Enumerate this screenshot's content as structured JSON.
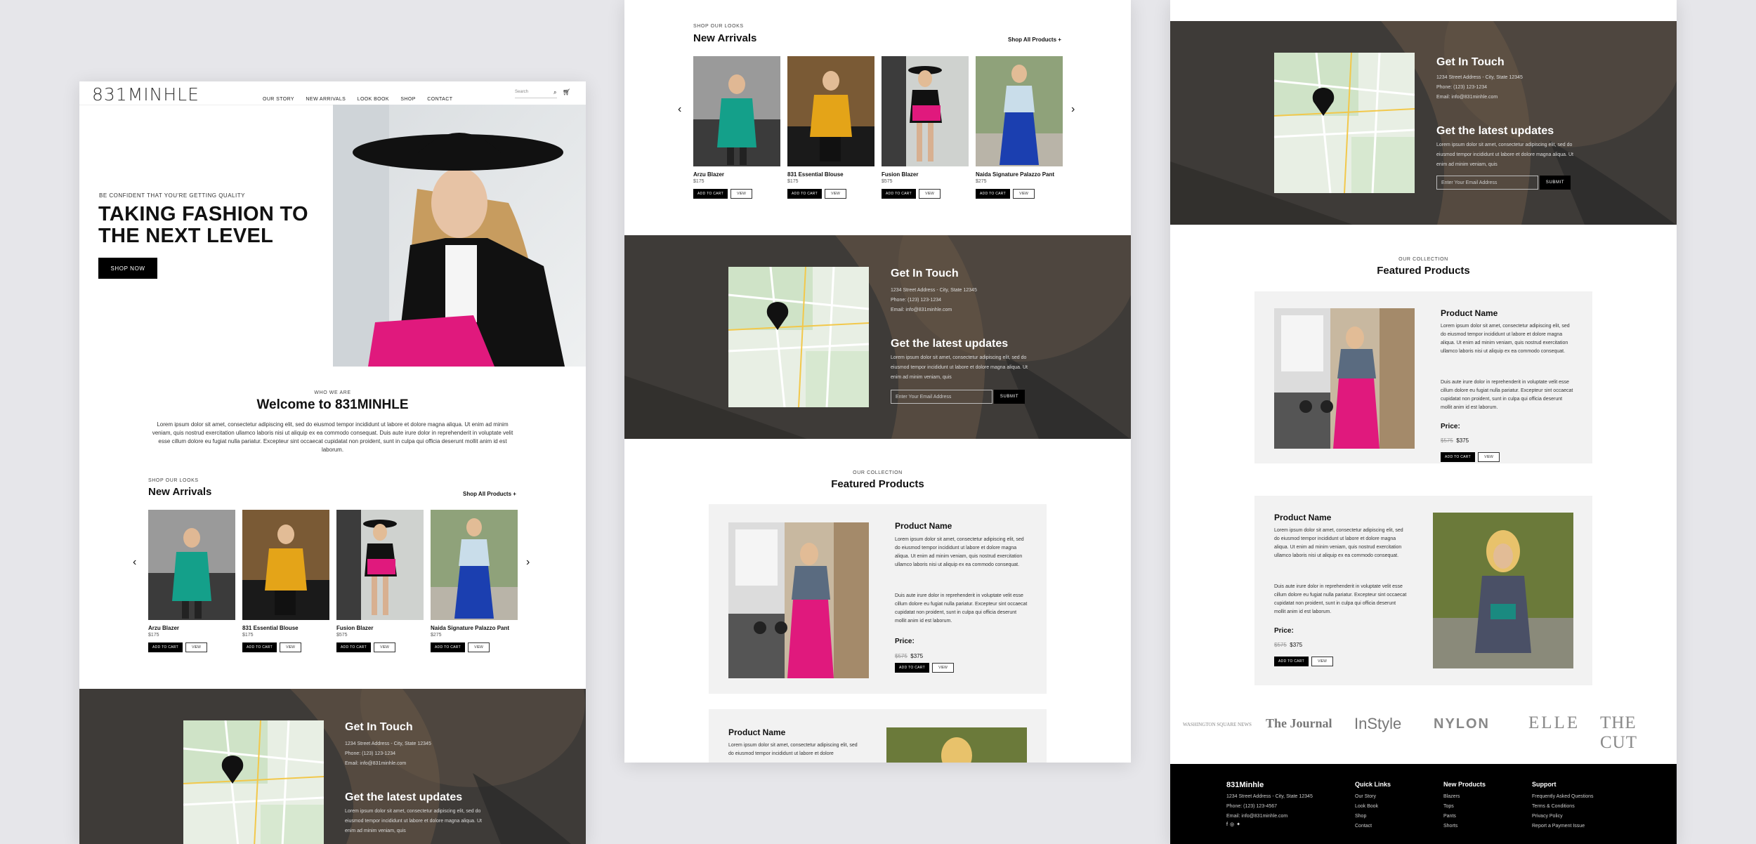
{
  "brand": {
    "logo": "831MINHLE"
  },
  "nav": {
    "items": [
      "OUR STORY",
      "NEW ARRIVALS",
      "LOOK BOOK",
      "SHOP",
      "CONTACT"
    ],
    "search_placeholder": "Search"
  },
  "hero": {
    "tagline": "BE CONFIDENT THAT YOU'RE GETTING QUALITY",
    "title_line1": "TAKING FASHION TO",
    "title_line2": "THE NEXT LEVEL",
    "cta": "SHOP NOW"
  },
  "welcome": {
    "eyebrow": "WHO WE ARE",
    "title": "Welcome to 831MINHLE",
    "body": "Lorem ipsum dolor sit amet, consectetur adipiscing elit, sed do eiusmod tempor incididunt ut labore et dolore magna aliqua. Ut enim ad minim veniam, quis nostrud exercitation ullamco laboris nisi ut aliquip ex ea commodo consequat. Duis aute irure dolor in reprehenderit in voluptate velit esse cillum dolore eu fugiat nulla pariatur. Excepteur sint occaecat cupidatat non proident, sunt in culpa qui officia deserunt mollit anim id est laborum."
  },
  "arrivals": {
    "eyebrow": "SHOP OUR LOOKS",
    "title": "New Arrivals",
    "shop_all": "Shop All Products +",
    "add_to_cart": "ADD TO CART",
    "view": "VIEW",
    "products": [
      {
        "name": "Arzu Blazer",
        "price": "$175"
      },
      {
        "name": "831 Essential Blouse",
        "price": "$175"
      },
      {
        "name": "Fusion Blazer",
        "price": "$575"
      },
      {
        "name": "Naida Signature Palazzo Pant",
        "price": "$275"
      }
    ]
  },
  "contact": {
    "title": "Get In Touch",
    "address": "1234 Street Address - City, State 12345",
    "phone": "Phone: (123) 123-1234",
    "email": "Email: info@831minhle.com",
    "updates_title": "Get the latest updates",
    "updates_body": "Lorem ipsum dolor sit amet, consectetur adipiscing elit, sed do eiusmod tempor incididunt ut labore et dolore magna aliqua. Ut enim ad minim veniam, quis",
    "email_placeholder": "Enter Your Email Address",
    "submit": "SUBMIT"
  },
  "featured": {
    "eyebrow": "OUR COLLECTION",
    "title": "Featured Products",
    "product_name": "Product Name",
    "p1": "Lorem ipsum dolor sit amet, consectetur adipiscing elit, sed do eiusmod tempor incididunt ut labore et dolore magna aliqua. Ut enim ad minim veniam, quis nostrud exercitation ullamco laboris nisi ut aliquip ex ea commodo consequat.",
    "p2": "Duis aute irure dolor in reprehenderit in voluptate velit esse cillum dolore eu fugiat nulla pariatur. Excepteur sint occaecat cupidatat non proident, sunt in culpa qui officia deserunt mollit anim id est laborum.",
    "price_label": "Price:",
    "old_price": "$575",
    "new_price": "$375",
    "add_to_cart": "ADD TO CART",
    "view": "VIEW",
    "partial_body": "Lorem ipsum dolor sit amet, consectetur adipiscing elit, sed do eiusmod tempor incididunt ut labore et dolore"
  },
  "press": [
    "WASHINGTON SQUARE NEWS",
    "The Journal",
    "InStyle",
    "NYLON",
    "ELLE",
    "THE CUT"
  ],
  "footer": {
    "brand": "831Minhle",
    "address": "1234 Street Address - City, State 12345",
    "phone": "Phone: (123) 123-4567",
    "email": "Email: info@831minhle.com",
    "quick_links_title": "Quick Links",
    "quick_links": [
      "Our Story",
      "Look Book",
      "Shop",
      "Contact"
    ],
    "new_products_title": "New Products",
    "new_products": [
      "Blazers",
      "Tops",
      "Pants",
      "Shorts"
    ],
    "support_title": "Support",
    "support": [
      "Frequently Asked Questions",
      "Terms & Conditions",
      "Privacy Policy",
      "Report a Payment Issue"
    ]
  },
  "colors": {
    "accent_pink": "#e0197d",
    "black": "#000000",
    "card_bg": "#f2f2f2"
  }
}
